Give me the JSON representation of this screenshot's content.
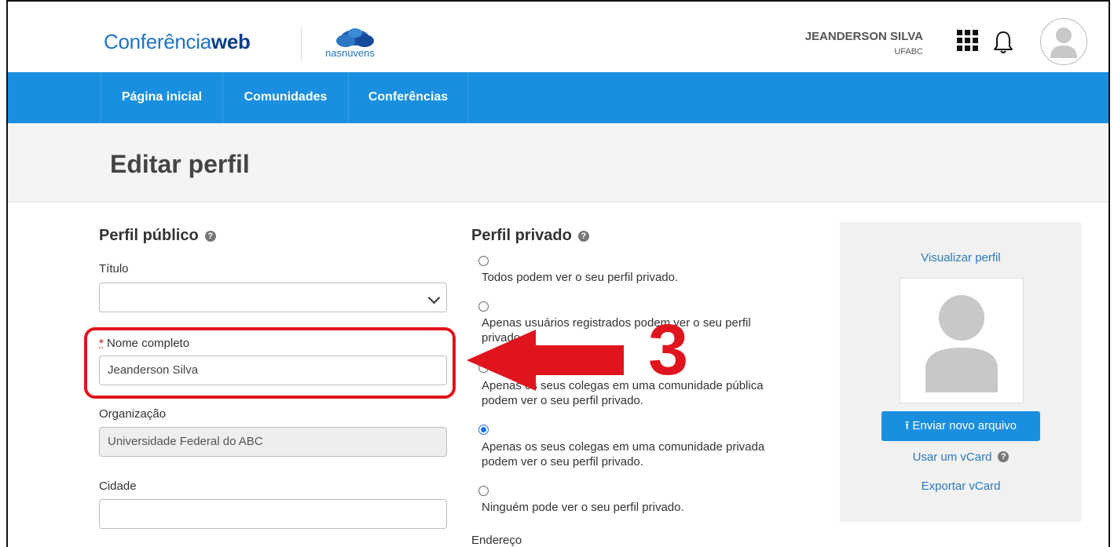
{
  "brand": {
    "logo_main": "Conferência",
    "logo_bold": "web",
    "partner": "nasnuvens"
  },
  "user": {
    "name": "JEANDERSON SILVA",
    "org": "UFABC"
  },
  "icons": {
    "apps": "apps-grid-icon",
    "notifications": "bell-icon",
    "avatar": "user-avatar-icon",
    "help": "help-circle-icon"
  },
  "nav": {
    "items": [
      {
        "label": "Página inicial"
      },
      {
        "label": "Comunidades"
      },
      {
        "label": "Conferências"
      }
    ]
  },
  "page": {
    "title": "Editar perfil"
  },
  "public_profile": {
    "heading": "Perfil público",
    "titulo_label": "Título",
    "titulo_value": "",
    "nome_required_mark": "*",
    "nome_label": "Nome completo",
    "nome_value": "Jeanderson Silva",
    "org_label": "Organização",
    "org_value": "Universidade Federal do ABC",
    "cidade_label": "Cidade",
    "cidade_value": ""
  },
  "private_profile": {
    "heading": "Perfil privado",
    "options": [
      {
        "label": "Todos podem ver o seu perfil privado.",
        "checked": false
      },
      {
        "label": "Apenas usuários registrados podem ver o seu perfil privado.",
        "checked": false
      },
      {
        "label": "Apenas os seus colegas em uma comunidade pública podem ver o seu perfil privado.",
        "checked": false
      },
      {
        "label": "Apenas os seus colegas em uma comunidade privada podem ver o seu perfil privado.",
        "checked": true
      },
      {
        "label": "Ninguém pode ver o seu perfil privado.",
        "checked": false
      }
    ],
    "endereco_label": "Endereço"
  },
  "photo": {
    "view_profile": "Visualizar perfil",
    "upload": "Enviar novo arquivo",
    "use_vcard": "Usar um vCard",
    "export_vcard": "Exportar vCard"
  },
  "annotation": {
    "step_number": "3",
    "color": "#e0141c"
  },
  "colors": {
    "nav_bg": "#1a8fe0",
    "link": "#2a7ac0"
  }
}
